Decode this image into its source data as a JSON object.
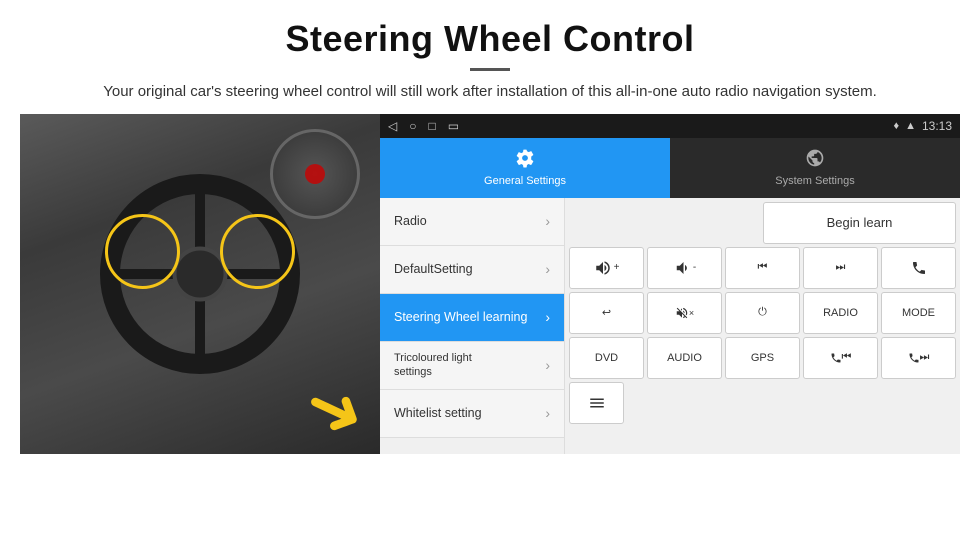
{
  "header": {
    "title": "Steering Wheel Control",
    "description": "Your original car's steering wheel control will still work after installation of this all-in-one auto radio navigation system."
  },
  "status_bar": {
    "time": "13:13",
    "icons": [
      "back",
      "home",
      "recent",
      "cast",
      "location",
      "signal"
    ]
  },
  "tabs": [
    {
      "id": "general",
      "label": "General Settings",
      "active": true
    },
    {
      "id": "system",
      "label": "System Settings",
      "active": false
    }
  ],
  "menu_items": [
    {
      "id": "radio",
      "label": "Radio",
      "active": false
    },
    {
      "id": "default",
      "label": "DefaultSetting",
      "active": false
    },
    {
      "id": "steering",
      "label": "Steering Wheel learning",
      "active": true
    },
    {
      "id": "tricoloured",
      "label": "Tricoloured light settings",
      "active": false
    },
    {
      "id": "whitelist",
      "label": "Whitelist setting",
      "active": false
    }
  ],
  "control_buttons": {
    "row0": {
      "empty": "",
      "learn": "Begin learn"
    },
    "row1": [
      {
        "label": "🔊+",
        "id": "vol-up"
      },
      {
        "label": "🔊-",
        "id": "vol-down"
      },
      {
        "label": "⏮",
        "id": "prev"
      },
      {
        "label": "⏭",
        "id": "next"
      },
      {
        "label": "📞",
        "id": "call"
      }
    ],
    "row2": [
      {
        "label": "↩",
        "id": "return"
      },
      {
        "label": "🔊×",
        "id": "mute"
      },
      {
        "label": "⏻",
        "id": "power"
      },
      {
        "label": "RADIO",
        "id": "radio"
      },
      {
        "label": "MODE",
        "id": "mode"
      }
    ],
    "row3": [
      {
        "label": "DVD",
        "id": "dvd"
      },
      {
        "label": "AUDIO",
        "id": "audio"
      },
      {
        "label": "GPS",
        "id": "gps"
      },
      {
        "label": "📞⏮",
        "id": "call-prev"
      },
      {
        "label": "📞⏭",
        "id": "call-next"
      }
    ],
    "row4": [
      {
        "label": "≡",
        "id": "menu"
      }
    ]
  }
}
